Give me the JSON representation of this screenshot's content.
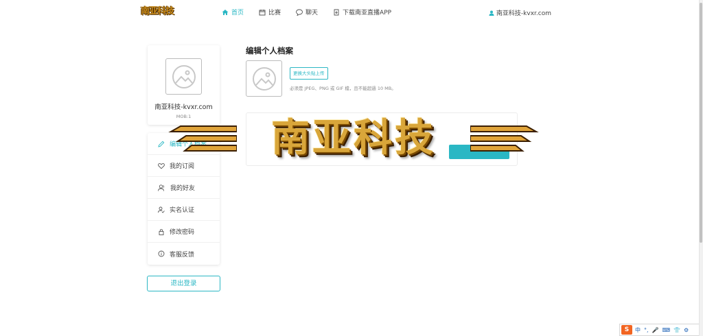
{
  "header": {
    "logo_text": "南亚科技",
    "nav": [
      {
        "label": "首页",
        "icon": "home-icon",
        "active": true
      },
      {
        "label": "比赛",
        "icon": "calendar-icon",
        "active": false
      },
      {
        "label": "聊天",
        "icon": "chat-bubble-icon",
        "active": false
      },
      {
        "label": "下载南亚直播APP",
        "icon": "download-icon",
        "active": false
      }
    ],
    "user_label": "南亚科技-kvxr.com"
  },
  "profile": {
    "name": "南亚科技-kvxr.com",
    "mob": "MOB:1"
  },
  "sidebar": {
    "items": [
      {
        "label": "编辑个人档案",
        "icon": "pencil-icon"
      },
      {
        "label": "我的订阅",
        "icon": "heart-icon"
      },
      {
        "label": "我的好友",
        "icon": "friends-icon"
      },
      {
        "label": "实名认证",
        "icon": "user-verify-icon"
      },
      {
        "label": "修改密码",
        "icon": "lock-icon"
      },
      {
        "label": "客服反馈",
        "icon": "info-icon"
      }
    ],
    "logout_label": "退出登录"
  },
  "main": {
    "title": "编辑个人档案",
    "upload_label": "更换大头贴上传",
    "upload_hint": "必须是 JPEG、PNG 或 GIF 檔，且不能超過 10 MB。"
  },
  "banner": {
    "text": "南亚科技"
  },
  "ime": {
    "logo": "S",
    "items": [
      "中",
      "°,",
      "🎤",
      "⌨",
      "👕",
      "⚙"
    ]
  },
  "colors": {
    "accent": "#2ab7c4",
    "banner_gold": "#d9a63a"
  }
}
